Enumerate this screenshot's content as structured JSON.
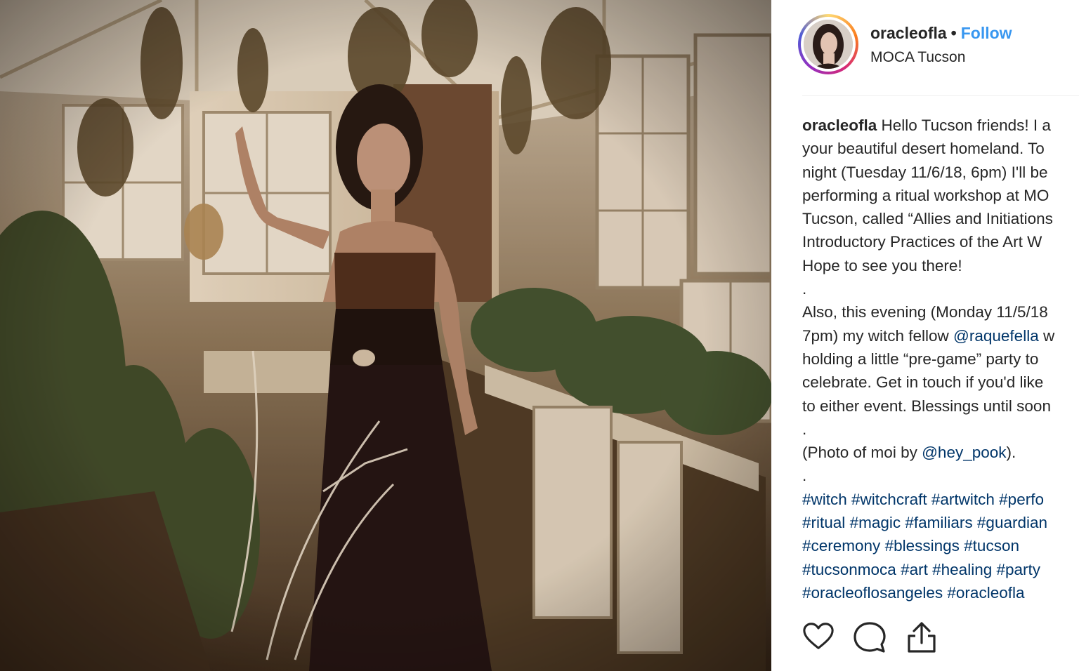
{
  "post": {
    "username": "oracleofla",
    "separator": "•",
    "follow_label": "Follow",
    "location": "MOCA Tucson",
    "caption_user": "oracleofla",
    "caption_lines": [
      [
        {
          "t": "text",
          "v": " Hello Tucson friends! I a"
        }
      ],
      [
        {
          "t": "text",
          "v": "your beautiful desert homeland. To"
        }
      ],
      [
        {
          "t": "text",
          "v": "night (Tuesday 11/6/18, 6pm) I'll be"
        }
      ],
      [
        {
          "t": "text",
          "v": "performing a ritual workshop at MO"
        }
      ],
      [
        {
          "t": "text",
          "v": "Tucson, called “Allies and Initiations"
        }
      ],
      [
        {
          "t": "text",
          "v": "Introductory Practices of the Art W"
        }
      ],
      [
        {
          "t": "text",
          "v": "Hope to see you there!"
        }
      ],
      [
        {
          "t": "text",
          "v": "."
        }
      ],
      [
        {
          "t": "text",
          "v": "Also, this evening (Monday 11/5/18"
        }
      ],
      [
        {
          "t": "text",
          "v": "7pm) my witch fellow "
        },
        {
          "t": "mention",
          "v": "@raquefella"
        },
        {
          "t": "text",
          "v": " w"
        }
      ],
      [
        {
          "t": "text",
          "v": "holding a little “pre-game” party to"
        }
      ],
      [
        {
          "t": "text",
          "v": "celebrate. Get in touch if you'd like"
        }
      ],
      [
        {
          "t": "text",
          "v": "to either event. Blessings until soon"
        }
      ],
      [
        {
          "t": "text",
          "v": "."
        }
      ],
      [
        {
          "t": "text",
          "v": "(Photo of moi by "
        },
        {
          "t": "mention",
          "v": "@hey_pook"
        },
        {
          "t": "text",
          "v": ")."
        }
      ],
      [
        {
          "t": "text",
          "v": "."
        }
      ],
      [
        {
          "t": "tag",
          "v": "#witch"
        },
        {
          "t": "text",
          "v": " "
        },
        {
          "t": "tag",
          "v": "#witchcraft"
        },
        {
          "t": "text",
          "v": " "
        },
        {
          "t": "tag",
          "v": "#artwitch"
        },
        {
          "t": "text",
          "v": " "
        },
        {
          "t": "tag",
          "v": "#perfo"
        }
      ],
      [
        {
          "t": "tag",
          "v": "#ritual"
        },
        {
          "t": "text",
          "v": " "
        },
        {
          "t": "tag",
          "v": "#magic"
        },
        {
          "t": "text",
          "v": " "
        },
        {
          "t": "tag",
          "v": "#familiars"
        },
        {
          "t": "text",
          "v": " "
        },
        {
          "t": "tag",
          "v": "#guardian"
        }
      ],
      [
        {
          "t": "tag",
          "v": "#ceremony"
        },
        {
          "t": "text",
          "v": " "
        },
        {
          "t": "tag",
          "v": "#blessings"
        },
        {
          "t": "text",
          "v": " "
        },
        {
          "t": "tag",
          "v": "#tucson"
        }
      ],
      [
        {
          "t": "tag",
          "v": "#tucsonmoca"
        },
        {
          "t": "text",
          "v": " "
        },
        {
          "t": "tag",
          "v": "#art"
        },
        {
          "t": "text",
          "v": " "
        },
        {
          "t": "tag",
          "v": "#healing"
        },
        {
          "t": "text",
          "v": " "
        },
        {
          "t": "tag",
          "v": "#party"
        }
      ],
      [
        {
          "t": "tag",
          "v": "#oracleoflosangeles"
        },
        {
          "t": "text",
          "v": " "
        },
        {
          "t": "tag",
          "v": "#oracleofla"
        }
      ]
    ]
  },
  "actions": {
    "like_icon": "heart-icon",
    "comment_icon": "comment-icon",
    "share_icon": "share-icon"
  },
  "colors": {
    "follow": "#3897f0",
    "link": "#003569",
    "text": "#262626"
  }
}
